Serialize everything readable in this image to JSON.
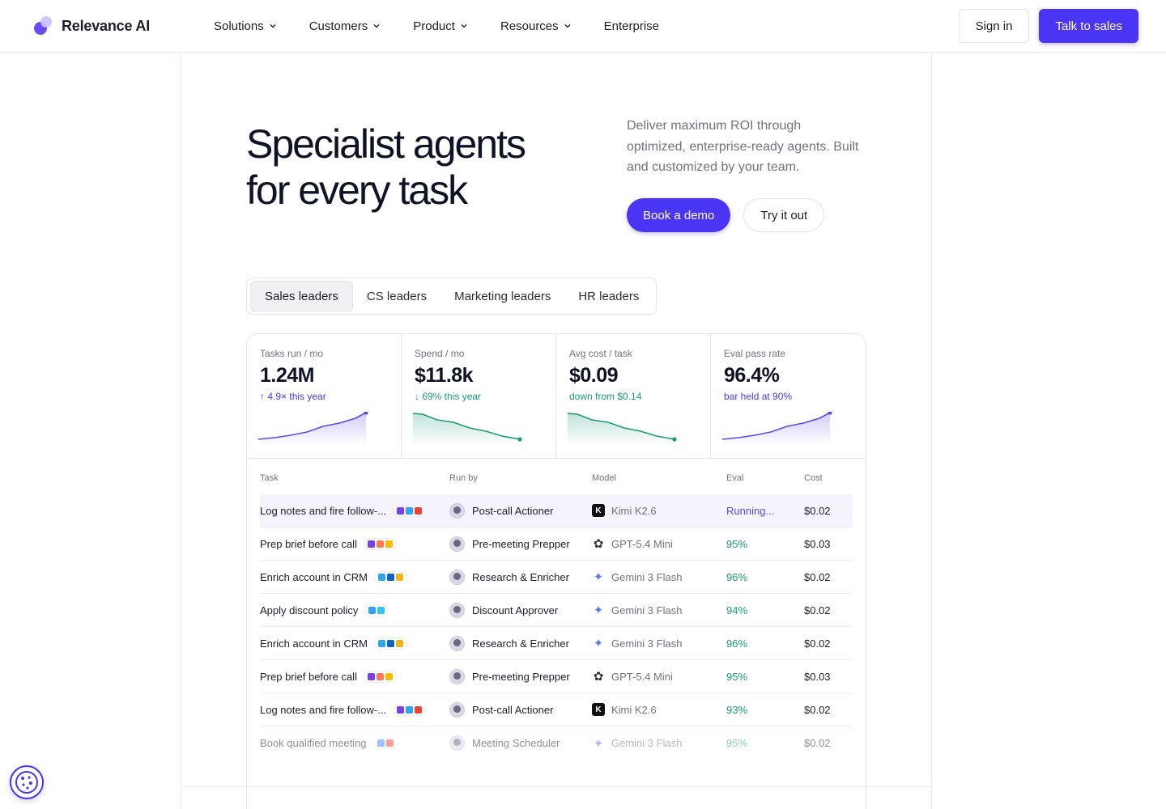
{
  "brand": {
    "name": "Relevance AI"
  },
  "nav": {
    "items": [
      {
        "label": "Solutions",
        "dropdown": true
      },
      {
        "label": "Customers",
        "dropdown": true
      },
      {
        "label": "Product",
        "dropdown": true
      },
      {
        "label": "Resources",
        "dropdown": true
      },
      {
        "label": "Enterprise",
        "dropdown": false
      }
    ],
    "sign_in": "Sign in",
    "talk_to_sales": "Talk to sales"
  },
  "hero": {
    "title_line1": "Specialist agents",
    "title_line2": "for every task",
    "subtitle": "Deliver maximum ROI through optimized, enterprise-ready agents. Built and customized by your team.",
    "book_demo": "Book a demo",
    "try_it": "Try it out"
  },
  "tabs": {
    "items": [
      "Sales leaders",
      "CS leaders",
      "Marketing leaders",
      "HR leaders"
    ],
    "active": "Sales leaders"
  },
  "kpis": [
    {
      "label": "Tasks run / mo",
      "value": "1.24M",
      "delta": "↑ 4.9× this year",
      "delta_color": "#4a35f5",
      "trend": "up"
    },
    {
      "label": "Spend / mo",
      "value": "$11.8k",
      "delta": "↓ 69% this year",
      "delta_color": "#1a9a7a",
      "trend": "down"
    },
    {
      "label": "Avg cost / task",
      "value": "$0.09",
      "delta": "down from $0.14",
      "delta_color": "#1a9a7a",
      "trend": "down"
    },
    {
      "label": "Eval pass rate",
      "value": "96.4%",
      "delta": "bar held at 90%",
      "delta_color": "#4a35f5",
      "trend": "up"
    }
  ],
  "table": {
    "headers": {
      "task": "Task",
      "run_by": "Run by",
      "model": "Model",
      "eval": "Eval",
      "cost": "Cost"
    },
    "rows": [
      {
        "task": "Log notes and fire follow-...",
        "run_by": "Post-call Actioner",
        "model": "Kimi K2.6",
        "model_icon": "kimi-icon",
        "eval": "Running...",
        "cost": "$0.02"
      },
      {
        "task": "Prep brief before call",
        "run_by": "Pre-meeting Prepper",
        "model": "GPT-5.4 Mini",
        "model_icon": "openai-icon",
        "eval": "95%",
        "cost": "$0.03"
      },
      {
        "task": "Enrich account in CRM",
        "run_by": "Research & Enricher",
        "model": "Gemini 3 Flash",
        "model_icon": "gemini-icon",
        "eval": "96%",
        "cost": "$0.02"
      },
      {
        "task": "Apply discount policy",
        "run_by": "Discount Approver",
        "model": "Gemini 3 Flash",
        "model_icon": "gemini-icon",
        "eval": "94%",
        "cost": "$0.02"
      },
      {
        "task": "Enrich account in CRM",
        "run_by": "Research & Enricher",
        "model": "Gemini 3 Flash",
        "model_icon": "gemini-icon",
        "eval": "96%",
        "cost": "$0.02"
      },
      {
        "task": "Prep brief before call",
        "run_by": "Pre-meeting Prepper",
        "model": "GPT-5.4 Mini",
        "model_icon": "openai-icon",
        "eval": "95%",
        "cost": "$0.03"
      },
      {
        "task": "Log notes and fire follow-...",
        "run_by": "Post-call Actioner",
        "model": "Kimi K2.6",
        "model_icon": "kimi-icon",
        "eval": "93%",
        "cost": "$0.02"
      },
      {
        "task": "Book qualified meeting",
        "run_by": "Meeting Scheduler",
        "model": "Gemini 3 Flash",
        "model_icon": "gemini-icon",
        "eval": "95%",
        "cost": "$0.02"
      }
    ]
  },
  "colors": {
    "accent": "#4a35f5",
    "green": "#1a9a7a",
    "border": "#e4e4ea"
  },
  "cookie": {
    "icon": "cookie-icon"
  }
}
